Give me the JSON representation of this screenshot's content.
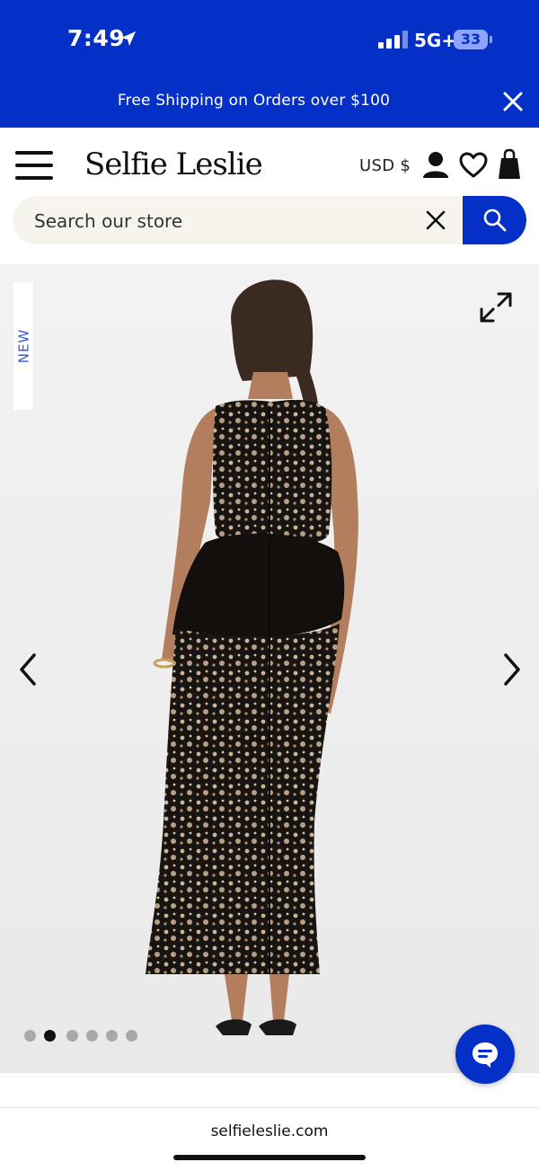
{
  "status_bar": {
    "time": "7:49",
    "network": "5G+",
    "battery": "33"
  },
  "promo": {
    "text": "Free Shipping on Orders over $100"
  },
  "header": {
    "logo": "Selfie Leslie",
    "currency": "USD $"
  },
  "search": {
    "placeholder": "Search our store"
  },
  "product": {
    "badge": "NEW",
    "image_alt": "Black lace sleeveless maxi dress with ruffled peplum, back view",
    "slides": 6,
    "active_slide": 2
  },
  "browser": {
    "url": "selfieleslie.com"
  },
  "colors": {
    "brand_blue": "#0530c7",
    "badge_text": "#3a54d9",
    "search_bg": "#f7f4ee"
  }
}
